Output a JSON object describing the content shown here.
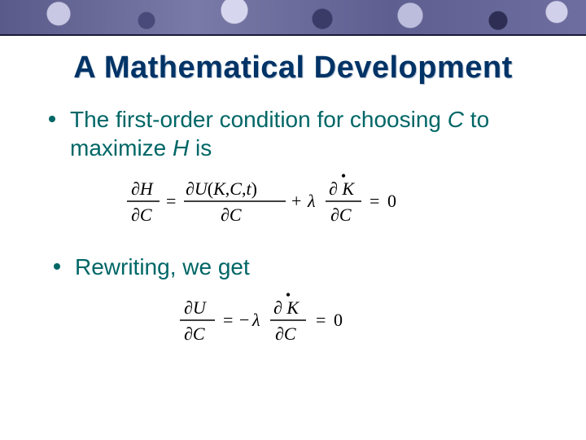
{
  "title": "A Mathematical Development",
  "bullets": [
    {
      "prefix": "The first-order condition for choosing ",
      "var1": "C",
      "mid": " to maximize ",
      "var2": "H",
      "suffix": " is"
    },
    {
      "text": "Rewriting, we get"
    }
  ],
  "equations": {
    "eq1": {
      "lhs_num": "∂H",
      "lhs_den": "∂C",
      "term1_num": "∂U(K,C,t)",
      "term1_den": "∂C",
      "plus": "+",
      "lambda": "λ",
      "term2_num": "∂K",
      "term2_dot": "·",
      "term2_den": "∂C",
      "eq": "=",
      "zero": "0"
    },
    "eq2": {
      "lhs_num": "∂U",
      "lhs_den": "∂C",
      "eq": "=",
      "neg": "−",
      "lambda": "λ",
      "rhs_num": "∂K",
      "rhs_dot": "·",
      "rhs_den": "∂C",
      "zero": "0"
    }
  }
}
